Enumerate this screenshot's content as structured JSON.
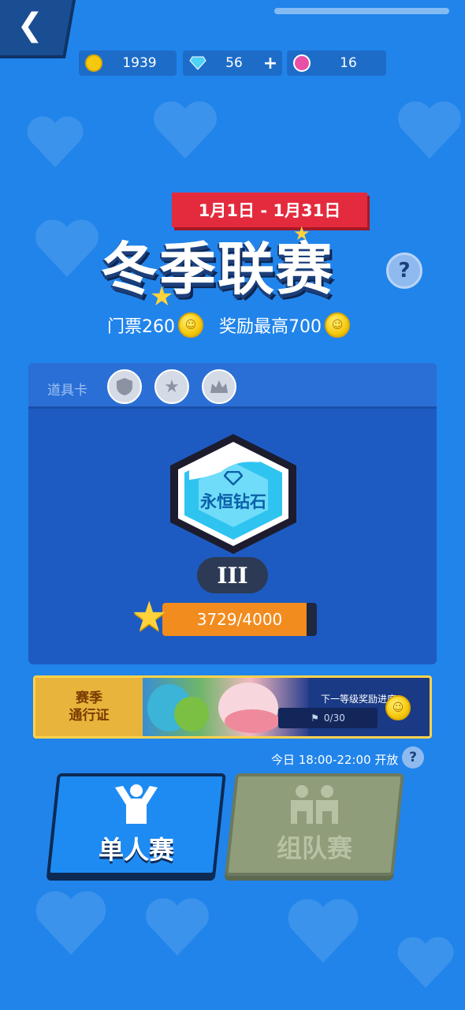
{
  "header": {
    "back_icon": "back-chevron-icon",
    "currencies": [
      {
        "name": "coin",
        "icon": "gold-coin-icon",
        "value": "1939",
        "color": "#f6c90e"
      },
      {
        "name": "diamond",
        "icon": "diamond-icon",
        "value": "56",
        "plus": "+",
        "color": "#4fd2f5"
      },
      {
        "name": "trophy",
        "icon": "pink-badge-icon",
        "value": "16",
        "color": "#e850a8"
      }
    ]
  },
  "event": {
    "date_range": "1月1日 - 1月31日",
    "title": "冬季联赛",
    "ticket_text": "门票260",
    "reward_text": "奖励最高700",
    "help": "?"
  },
  "panel": {
    "tools_label": "道具卡",
    "tools": [
      {
        "icon": "shield-icon"
      },
      {
        "icon": "star-icon"
      },
      {
        "icon": "crown-icon"
      }
    ],
    "rank_name": "永恒钻石",
    "tier": "III",
    "progress_text_current": "3729",
    "progress_text_total": "/4000",
    "progress_value": 3729,
    "progress_max": 4000
  },
  "season_pass": {
    "line1": "赛季",
    "line2": "通行证",
    "next_reward_label": "下一等级奖励进度",
    "progress": "0/30"
  },
  "schedule": {
    "open_time": "今日 18:00-22:00 开放",
    "help": "?"
  },
  "modes": {
    "solo_label": "单人赛",
    "team_label": "组队赛"
  },
  "colors": {
    "background": "#2184ea",
    "accent_red": "#e42b3d",
    "progress_orange": "#f28c1e",
    "pass_gold": "#ffd24a"
  }
}
